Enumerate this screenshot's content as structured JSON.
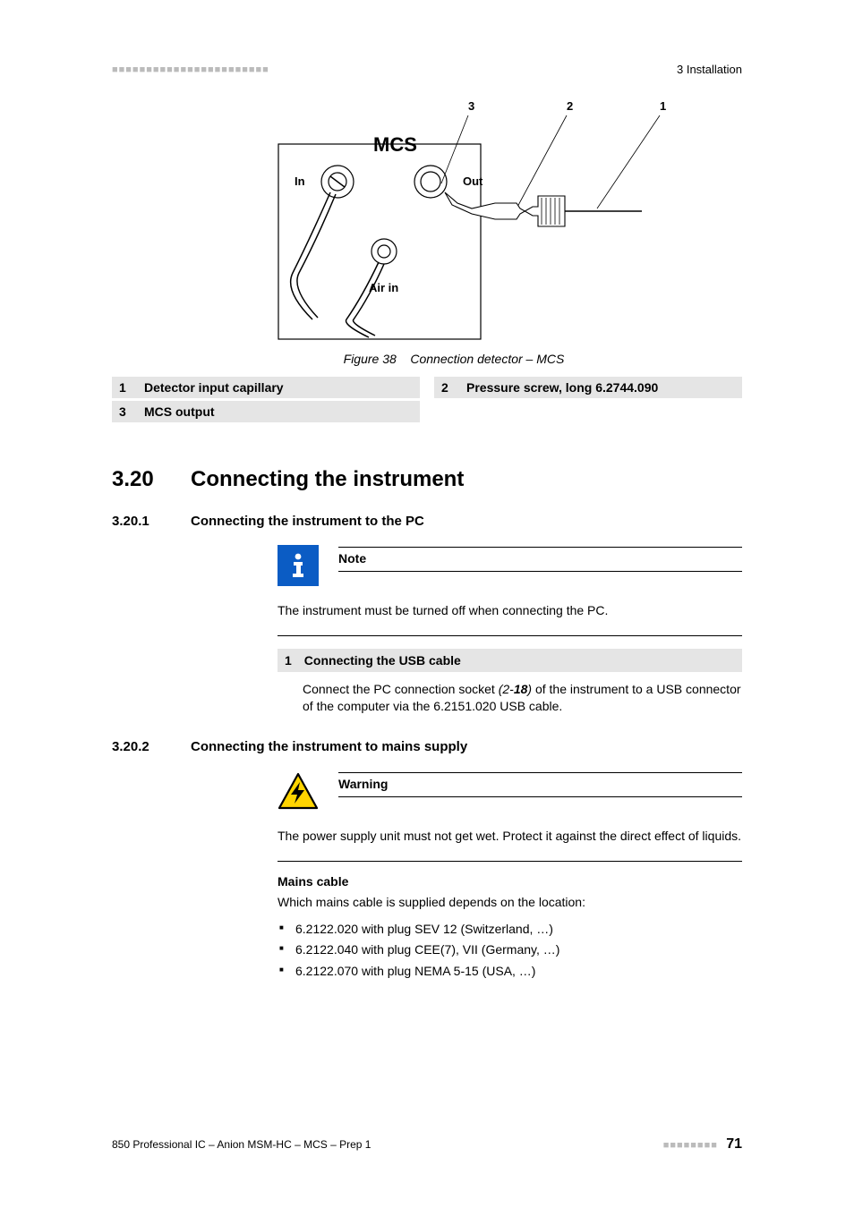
{
  "header": {
    "right": "3 Installation"
  },
  "figure": {
    "callouts": [
      "3",
      "2",
      "1"
    ],
    "title": "MCS",
    "in": "In",
    "out": "Out",
    "airin": "Air in",
    "caption_prefix": "Figure 38",
    "caption_text": "Connection detector – MCS"
  },
  "legend": [
    {
      "n": "1",
      "t": "Detector input capillary"
    },
    {
      "n": "2",
      "t": "Pressure screw, long 6.2744.090"
    },
    {
      "n": "3",
      "t": "MCS output"
    }
  ],
  "sections": {
    "s320": {
      "num": "3.20",
      "title": "Connecting the instrument"
    },
    "s3201": {
      "num": "3.20.1",
      "title": "Connecting the instrument to the PC"
    },
    "s3202": {
      "num": "3.20.2",
      "title": "Connecting the instrument to mains supply"
    }
  },
  "note": {
    "title": "Note",
    "body": "The instrument must be turned off when connecting the PC."
  },
  "step": {
    "num": "1",
    "title": "Connecting the USB cable",
    "body_a": "Connect the PC connection socket ",
    "body_ref1": "(2-",
    "body_ref2": "18",
    "body_ref3": ")",
    "body_b": " of the instrument to a USB connector of the computer via the 6.2151.020 USB cable."
  },
  "warning": {
    "title": "Warning",
    "body": "The power supply unit must not get wet. Protect it against the direct effect of liquids."
  },
  "mains": {
    "head": "Mains cable",
    "intro": "Which mains cable is supplied depends on the location:",
    "items": [
      "6.2122.020 with plug SEV 12 (Switzerland, …)",
      "6.2122.040 with plug CEE(7), VII (Germany, …)",
      "6.2122.070 with plug NEMA 5-15 (USA, …)"
    ]
  },
  "footer": {
    "left": "850 Professional IC – Anion MSM-HC – MCS – Prep 1",
    "page": "71"
  }
}
